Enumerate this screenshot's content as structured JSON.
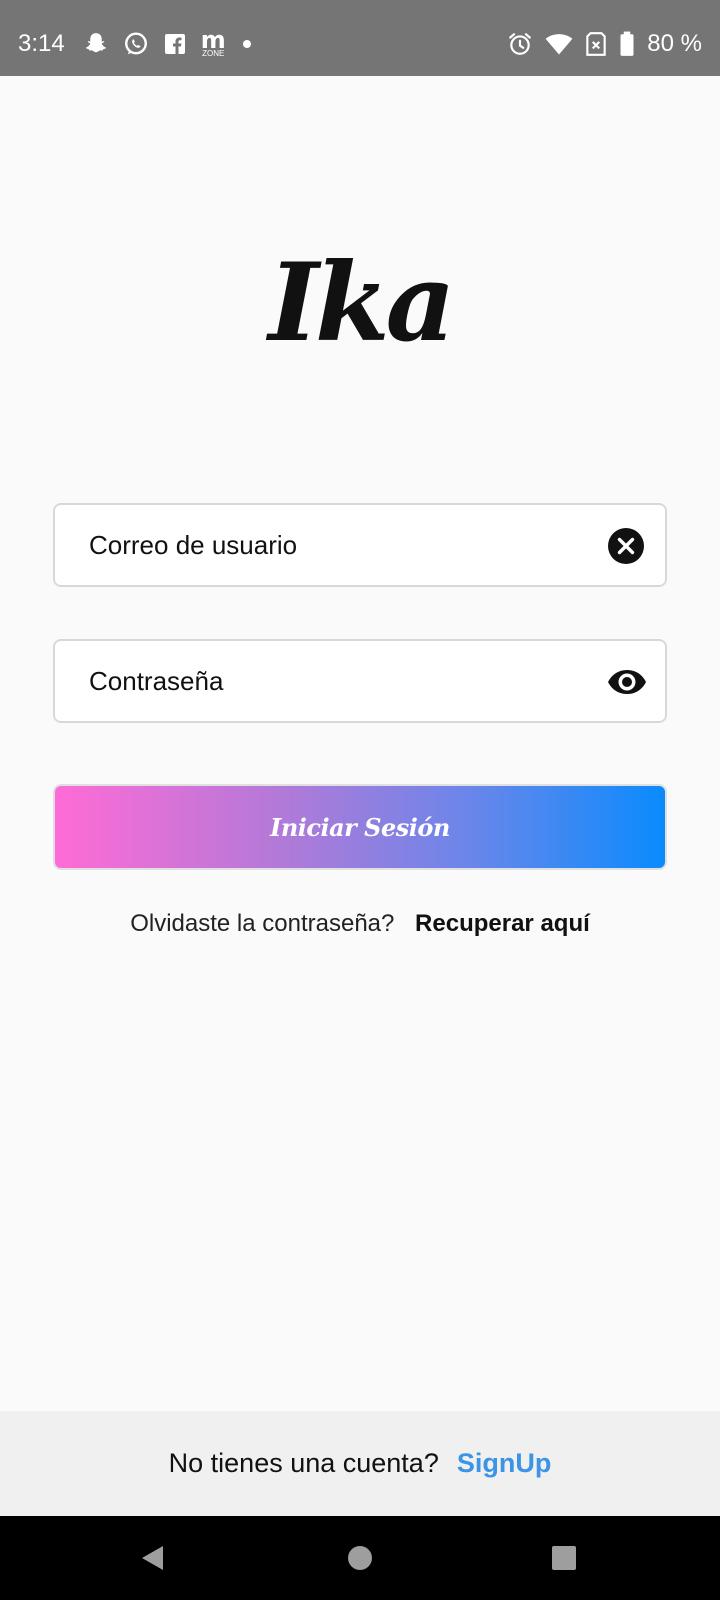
{
  "status_bar": {
    "time": "3:14",
    "notification_icons": [
      "snapchat-icon",
      "whatsapp-icon",
      "facebook-icon",
      "mzone-icon",
      "dot-icon"
    ],
    "mzone_m": "m",
    "mzone_zone": "ZONE",
    "system_icons": [
      "alarm-icon",
      "wifi-icon",
      "sim-icon",
      "battery-icon"
    ],
    "battery": "80 %"
  },
  "app": {
    "logo": "Ika"
  },
  "form": {
    "email_placeholder": "Correo de usuario",
    "password_placeholder": "Contraseña",
    "clear_icon": "clear-icon",
    "visibility_icon": "eye-icon",
    "login_label": "Iniciar Sesión",
    "login_gradient": [
      "#ff6bd6",
      "#0a8bfd"
    ]
  },
  "forgot": {
    "text": "Olvidaste la contraseña?",
    "link": "Recuperar aquí"
  },
  "signup": {
    "text": "No tienes una cuenta?",
    "link": "SignUp",
    "link_color": "#3b94e5"
  },
  "nav": {
    "icons": [
      "back-icon",
      "home-icon",
      "recents-icon"
    ]
  }
}
